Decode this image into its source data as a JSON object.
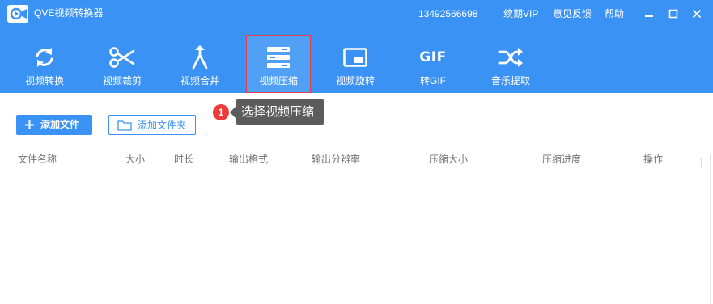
{
  "app": {
    "title": "QVE视频转换器"
  },
  "titlebar": {
    "phone": "13492566698",
    "vip": "续期VIP",
    "feedback": "意见反馈",
    "help": "帮助"
  },
  "toolbar": {
    "items": [
      {
        "label": "视频转换",
        "icon": "convert-icon"
      },
      {
        "label": "视频裁剪",
        "icon": "scissors-icon"
      },
      {
        "label": "视频合并",
        "icon": "merge-icon"
      },
      {
        "label": "视频压缩",
        "icon": "compress-icon",
        "active": true
      },
      {
        "label": "视频旋转",
        "icon": "rotate-icon"
      },
      {
        "label": "转GIF",
        "icon": "gif-icon",
        "icon_text": "GIF"
      },
      {
        "label": "音乐提取",
        "icon": "shuffle-icon"
      }
    ]
  },
  "actions": {
    "add_file": "添加文件",
    "add_folder": "添加文件夹"
  },
  "guide": {
    "step": "1",
    "text": "选择视频压缩"
  },
  "table": {
    "columns": [
      "文件名称",
      "大小",
      "时长",
      "输出格式",
      "输出分辨率",
      "压缩大小",
      "压缩进度",
      "操作"
    ]
  },
  "colors": {
    "primary": "#3b92f5",
    "highlight_border": "#e0424a",
    "badge": "#ee3a3a",
    "tooltip_bg": "#5c5c5c"
  }
}
